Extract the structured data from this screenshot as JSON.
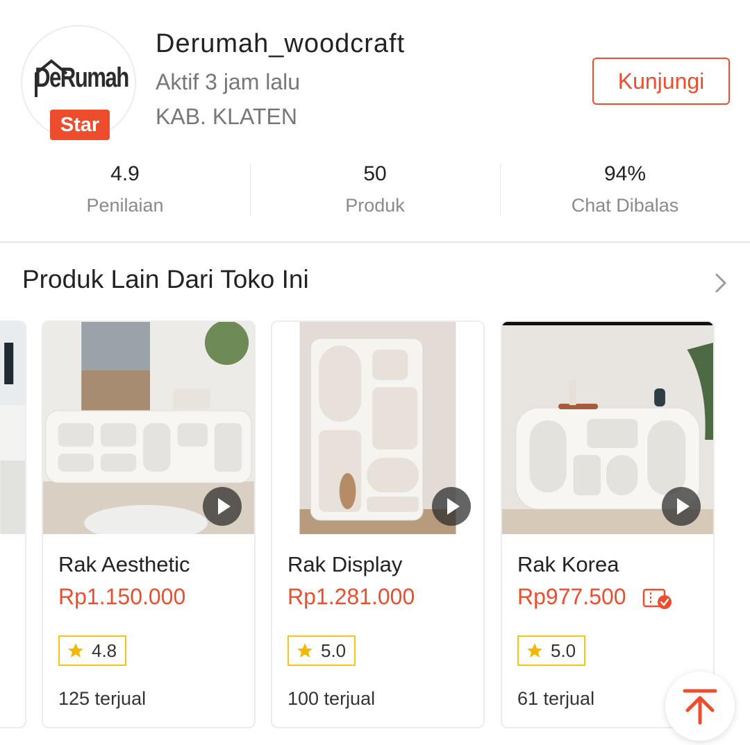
{
  "shop": {
    "logo_text": "DeRumah",
    "badge": "Star",
    "name": "Derumah_woodcraft",
    "status": "Aktif 3 jam lalu",
    "location": "KAB. KLATEN",
    "visit_label": "Kunjungi"
  },
  "stats": [
    {
      "value": "4.9",
      "label": "Penilaian"
    },
    {
      "value": "50",
      "label": "Produk"
    },
    {
      "value": "94%",
      "label": "Chat Dibalas"
    }
  ],
  "section": {
    "title": "Produk Lain Dari Toko Ini"
  },
  "products": [
    {
      "name": "Rak Aesthetic",
      "price": "Rp1.150.000",
      "rating": "4.8",
      "sold": "125 terjual",
      "has_video": true
    },
    {
      "name": "Rak Display",
      "price": "Rp1.281.000",
      "rating": "5.0",
      "sold": "100 terjual",
      "has_video": true
    },
    {
      "name": "Rak Korea",
      "price": "Rp977.500",
      "rating": "5.0",
      "sold": "61 terjual",
      "has_video": true,
      "has_voucher": true
    }
  ],
  "colors": {
    "accent": "#ee4d2d",
    "rating_border": "#f5c518",
    "star": "#f5b800"
  },
  "icons": [
    "logo-house-icon",
    "chevron-right-icon",
    "play-icon",
    "star-icon",
    "voucher-icon",
    "back-to-top-icon"
  ]
}
